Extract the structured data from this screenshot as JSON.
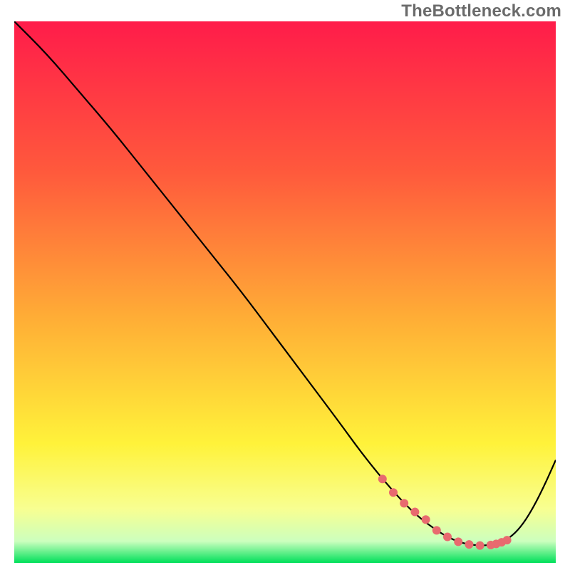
{
  "watermark": "TheBottleneck.com",
  "chart_data": {
    "type": "line",
    "title": "",
    "xlabel": "",
    "ylabel": "",
    "xlim": [
      0,
      100
    ],
    "ylim": [
      0,
      100
    ],
    "grid": false,
    "legend": false,
    "gradient_stops": [
      {
        "offset": 0,
        "color": "#ff1c4a"
      },
      {
        "offset": 28,
        "color": "#ff5a3c"
      },
      {
        "offset": 55,
        "color": "#ffae36"
      },
      {
        "offset": 78,
        "color": "#fff23a"
      },
      {
        "offset": 90,
        "color": "#f8ff91"
      },
      {
        "offset": 96,
        "color": "#ccffbe"
      },
      {
        "offset": 100,
        "color": "#00e05a"
      }
    ],
    "series": [
      {
        "name": "bottleneck-curve",
        "color": "#000000",
        "x": [
          0,
          6,
          12,
          18,
          24,
          30,
          36,
          42,
          48,
          54,
          60,
          64,
          68,
          72,
          75,
          78,
          80,
          82,
          84,
          86,
          88,
          90,
          92,
          94,
          96,
          98,
          100
        ],
        "y": [
          100,
          94,
          87,
          80,
          72.5,
          65,
          57.5,
          50,
          42,
          34,
          26,
          20.5,
          15.5,
          11,
          8.2,
          6.0,
          4.8,
          3.9,
          3.4,
          3.2,
          3.3,
          3.8,
          5.0,
          7.2,
          10.5,
          14.5,
          19
        ]
      }
    ],
    "annotations": {
      "valley_markers": {
        "color": "#e86a6f",
        "radius_px": 6,
        "x": [
          68,
          70,
          72,
          74,
          76,
          78,
          80,
          82,
          84,
          86,
          88,
          89,
          90,
          91
        ],
        "y": [
          15.5,
          13.0,
          11.0,
          9.4,
          8.0,
          6.0,
          4.8,
          3.9,
          3.4,
          3.2,
          3.3,
          3.5,
          3.8,
          4.2
        ]
      }
    }
  }
}
